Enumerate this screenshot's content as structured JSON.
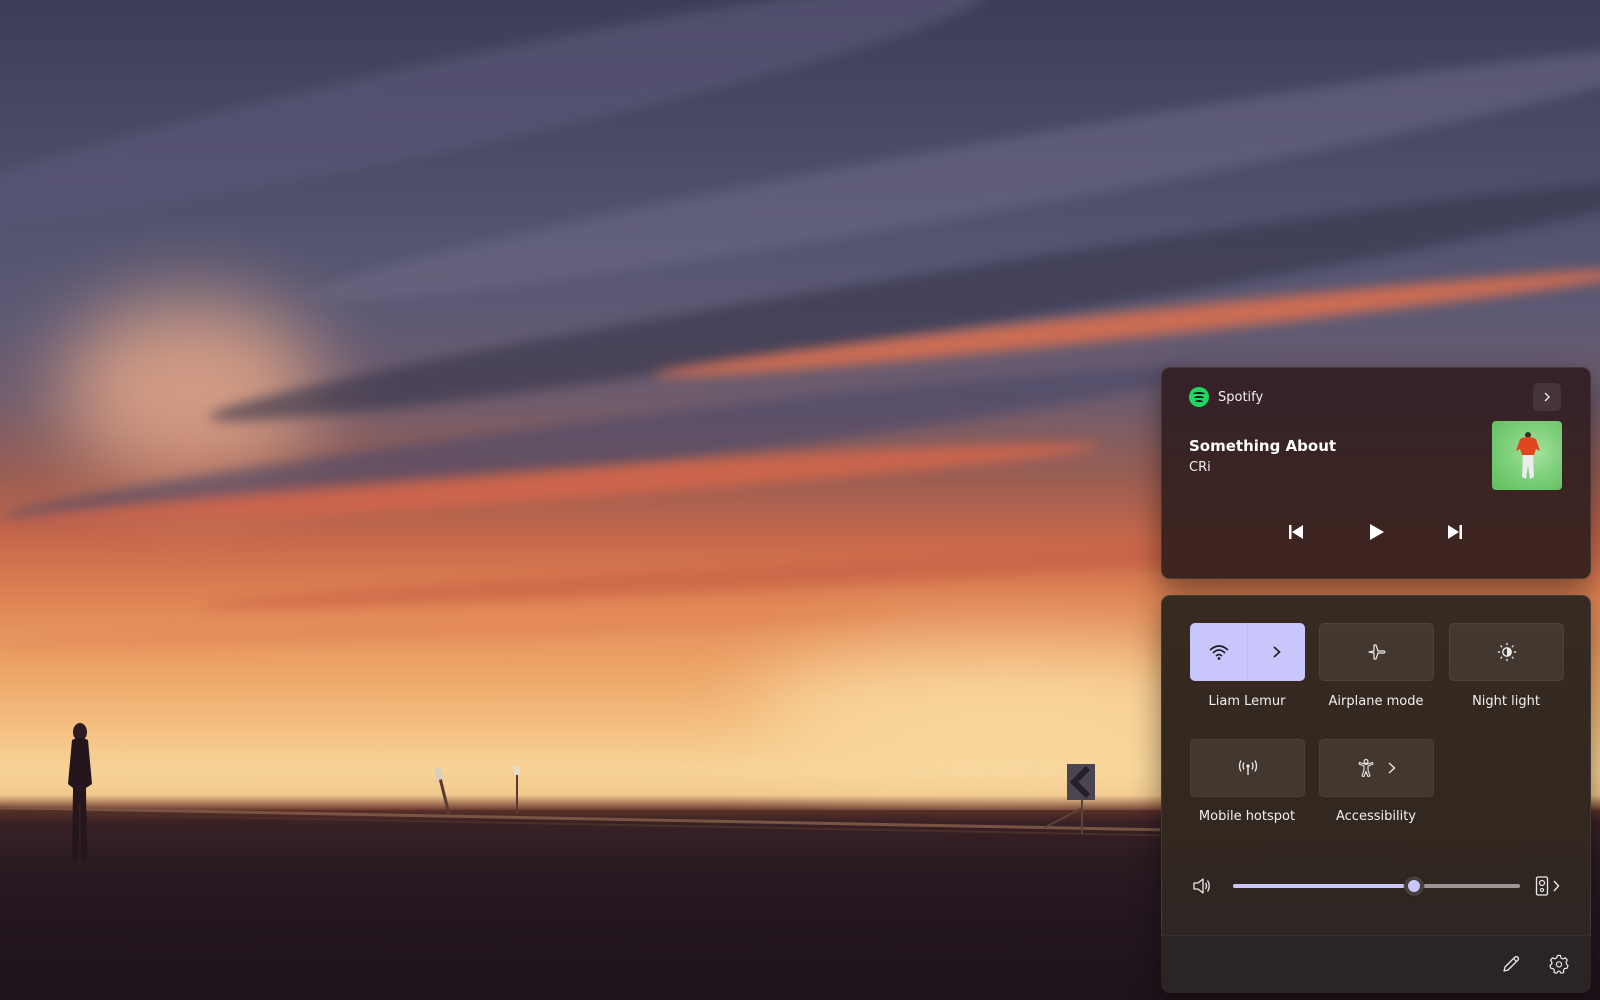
{
  "media": {
    "app_name": "Spotify",
    "app_icon": "spotify-icon",
    "expand_icon": "chevron-right-icon",
    "track_title": "Something About",
    "artist": "CRi",
    "controls": [
      {
        "name": "previous-track",
        "icon": "skip-back-icon"
      },
      {
        "name": "play",
        "icon": "play-icon"
      },
      {
        "name": "next-track",
        "icon": "skip-forward-icon"
      }
    ]
  },
  "quick_settings": {
    "tiles": [
      {
        "label": "Liam Lemur",
        "icon": "wifi-icon",
        "active": true,
        "has_chevron": true,
        "split": true
      },
      {
        "label": "Airplane mode",
        "icon": "airplane-icon",
        "active": false,
        "has_chevron": false
      },
      {
        "label": "Night light",
        "icon": "night-light-icon",
        "active": false,
        "has_chevron": false
      },
      {
        "label": "Mobile hotspot",
        "icon": "hotspot-icon",
        "active": false,
        "has_chevron": false
      },
      {
        "label": "Accessibility",
        "icon": "accessibility-icon",
        "active": false,
        "has_chevron": true
      }
    ],
    "volume": {
      "icon": "speaker-icon",
      "level_fraction": 0.63,
      "output_device_icon": "speaker-device-icon",
      "device_chevron_icon": "chevron-right-icon"
    },
    "footer": {
      "edit_icon": "pencil-icon",
      "settings_icon": "gear-icon"
    }
  },
  "colors": {
    "accent": "#c9c6fb",
    "spotify_green": "#1ed760"
  }
}
